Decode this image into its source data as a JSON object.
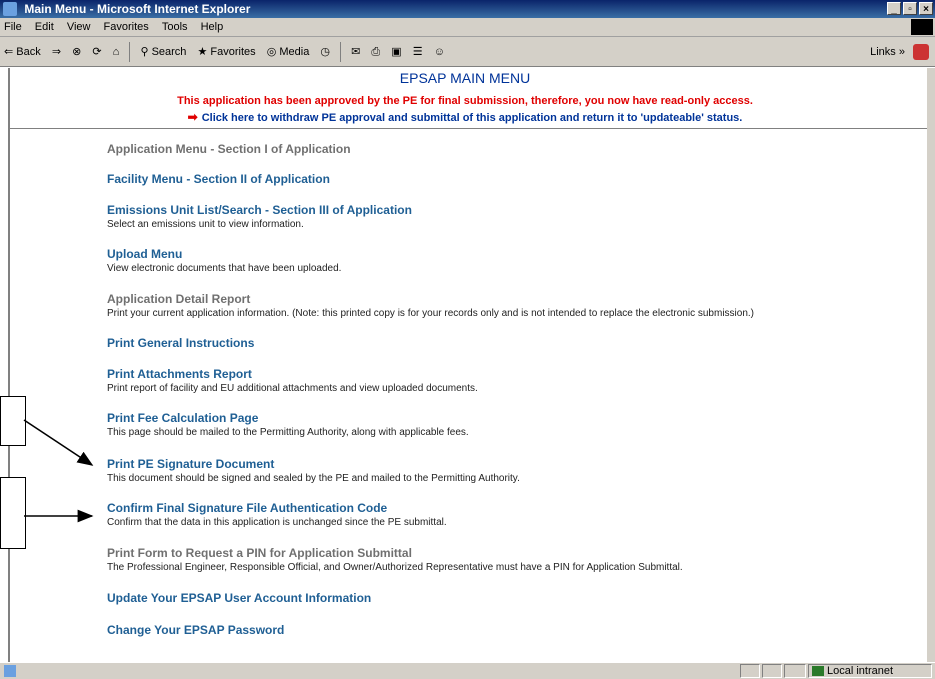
{
  "window": {
    "title": "Main Menu - Microsoft Internet Explorer"
  },
  "menubar": {
    "items": [
      "File",
      "Edit",
      "View",
      "Favorites",
      "Tools",
      "Help"
    ]
  },
  "toolbar": {
    "back": "Back",
    "search": "Search",
    "favorites": "Favorites",
    "media": "Media",
    "links": "Links"
  },
  "page": {
    "title": "EPSAP MAIN MENU",
    "notice_red": "This application has been approved by the PE for final submission, therefore, you now have read-only access.",
    "notice_blue": "Click here to withdraw PE approval and submittal of this application and return it to 'updateable' status.",
    "menu": [
      {
        "label": "Application Menu - Section I of Application",
        "desc": ""
      },
      {
        "label": "Facility Menu - Section II of Application",
        "desc": ""
      },
      {
        "label": "Emissions Unit List/Search - Section III of Application",
        "desc": "Select an emissions unit to view information."
      },
      {
        "label": "Upload Menu",
        "desc": "View electronic documents that have been uploaded."
      },
      {
        "label": "Application Detail Report",
        "desc": "Print your current application information. (Note: this printed copy is for your records only and is not intended to replace the electronic submission.)"
      },
      {
        "label": "Print General Instructions",
        "desc": ""
      },
      {
        "label": "Print Attachments Report",
        "desc": "Print report of facility and EU additional attachments and view uploaded documents."
      },
      {
        "label": "Print Fee Calculation Page",
        "desc": "This page should be mailed to the Permitting Authority, along with applicable fees."
      },
      {
        "label": "Print PE Signature Document",
        "desc": "This document should be signed and sealed by the PE and mailed to the Permitting Authority."
      },
      {
        "label": "Confirm Final Signature File Authentication Code",
        "desc": "Confirm that the data in this application is unchanged since the PE submittal."
      },
      {
        "label": "Print Form to Request a PIN for Application Submittal",
        "desc": "The Professional Engineer, Responsible Official, and Owner/Authorized Representative must have a PIN for Application Submittal."
      },
      {
        "label": "Update Your EPSAP User Account Information",
        "desc": ""
      },
      {
        "label": "Change Your EPSAP Password",
        "desc": ""
      }
    ]
  },
  "statusbar": {
    "zone": "Local intranet"
  },
  "colors": {
    "link_blue": "#1f5f94",
    "link_gray": "#707070",
    "notice_red": "#e00000",
    "title_blue": "#003399"
  }
}
